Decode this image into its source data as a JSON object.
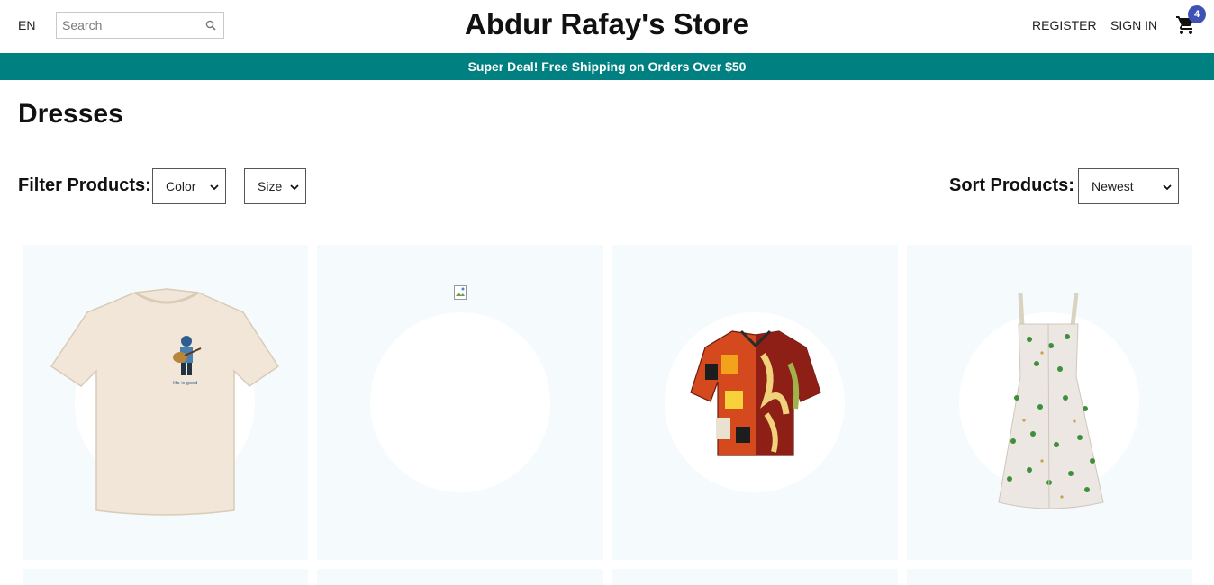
{
  "header": {
    "language": "EN",
    "search_placeholder": "Search",
    "store_title": "Abdur Rafay's Store",
    "register_label": "REGISTER",
    "signin_label": "SIGN IN",
    "cart_count": "4"
  },
  "announcement": "Super Deal! Free Shipping on Orders Over $50",
  "page_title": "Dresses",
  "filters": {
    "label": "Filter Products:",
    "color_selected": "Color",
    "size_selected": "Size"
  },
  "sort": {
    "label": "Sort Products:",
    "selected": "Newest"
  },
  "products": [
    {
      "name": "tshirt-guitar-print",
      "t_shirt_print": "life is good"
    },
    {
      "name": "missing-image-product"
    },
    {
      "name": "printed-hawaiian-shirt"
    },
    {
      "name": "floral-sundress"
    }
  ],
  "colors": {
    "announcement_bg": "#008080",
    "card_bg": "#f5fbfd",
    "badge_bg": "#3f51b5"
  }
}
